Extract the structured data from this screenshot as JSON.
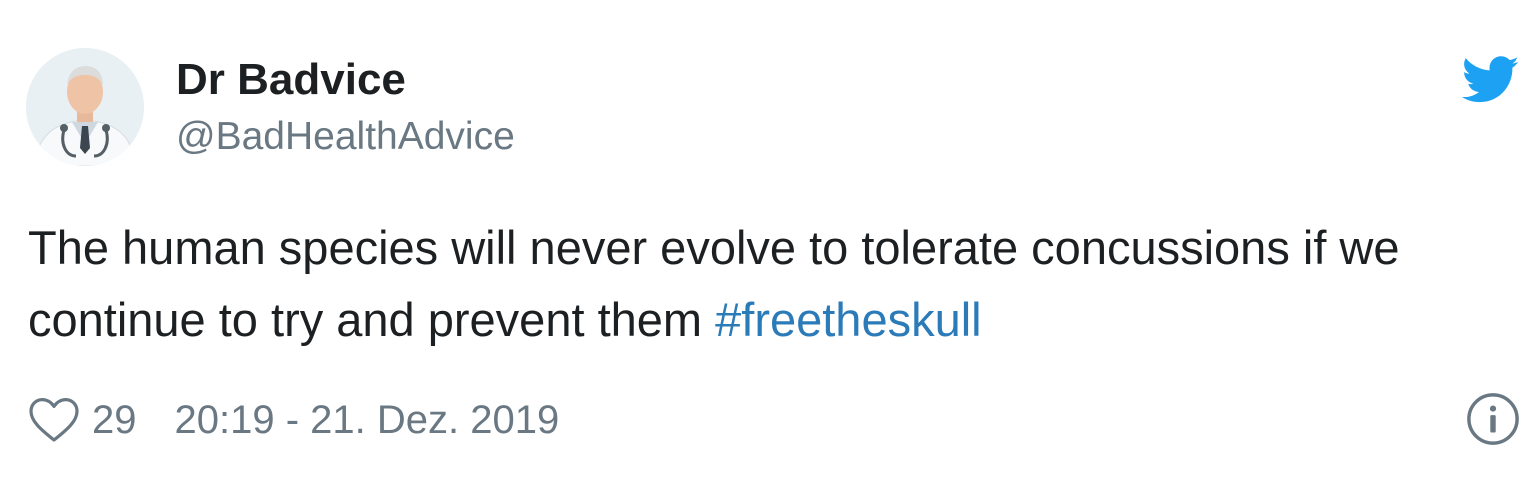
{
  "author": {
    "display_name": "Dr Badvice",
    "handle": "@BadHealthAdvice",
    "avatar_icon": "doctor-avatar"
  },
  "tweet": {
    "text": "The human species will never evolve to tolerate concussions if we continue to try and prevent them ",
    "hashtag": "#freetheskull"
  },
  "footer": {
    "like_icon": "heart-icon",
    "like_count": "29",
    "timestamp": "20:19 - 21. Dez. 2019",
    "info_icon": "info-icon"
  },
  "branding": {
    "logo_icon": "twitter-bird-icon",
    "brand_color": "#1da1f2",
    "link_color": "#2b7bb9",
    "muted_color": "#697882"
  }
}
